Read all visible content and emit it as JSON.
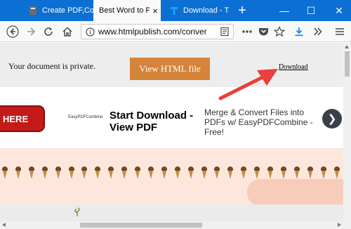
{
  "tabs": [
    {
      "label": "Create PDF,Co",
      "active": false,
      "favicon": "pdf-book-icon"
    },
    {
      "label": "Best Word to PD",
      "active": true
    },
    {
      "label": "Download - Tả",
      "active": false,
      "favicon": "t-icon"
    }
  ],
  "tab_close": "×",
  "new_tab": "+",
  "window": {
    "minimize": "—",
    "maximize": "☐",
    "close": "✕"
  },
  "nav": {
    "url": "www.htmlpublish.com/conver",
    "icons": [
      "back-icon",
      "forward-icon",
      "reload-icon",
      "home-icon",
      "reader-view-icon",
      "page-actions-icon",
      "pocket-icon",
      "bookmark-star-icon",
      "download-icon",
      "overflow-icon",
      "menu-icon"
    ]
  },
  "page": {
    "private_text": "Your document is private.",
    "view_button": "View HTML file",
    "download_link": "Download"
  },
  "ad": {
    "here_label": "HERE",
    "logo_text": "EasyPDFCombine",
    "headline": "Start Download - View PDF",
    "subtext": "Merge & Convert Files into PDFs w/ EasyPDFCombine - Free!",
    "next_label": "❯"
  },
  "colors": {
    "tabbar": "#0c6fd3",
    "view_button": "#d5843a",
    "arrow": "#e8403a",
    "banner": "#fde7dc"
  }
}
